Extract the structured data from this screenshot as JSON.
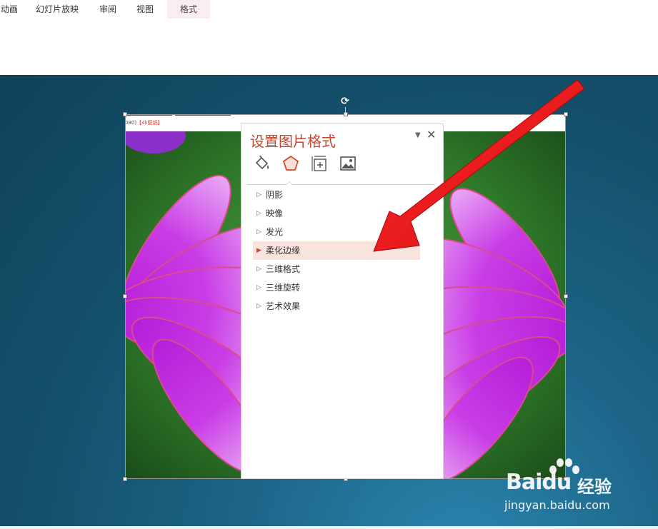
{
  "ribbon": {
    "tabs": [
      {
        "label": "动画",
        "active": false
      },
      {
        "label": "幻灯片放映",
        "active": false
      },
      {
        "label": "审阅",
        "active": false
      },
      {
        "label": "视图",
        "active": false
      },
      {
        "label": "格式",
        "active": true
      }
    ]
  },
  "picture": {
    "caption_prefix": "080)",
    "caption_red": "【4k壁纸】"
  },
  "pane": {
    "title": "设置图片格式",
    "dropdown_icon": "triangle-down-icon",
    "close_icon": "close-icon",
    "icons": [
      "fill-line-icon",
      "effects-pentagon-icon",
      "size-properties-icon",
      "picture-icon"
    ],
    "sections": [
      {
        "label": "阴影",
        "highlighted": false
      },
      {
        "label": "映像",
        "highlighted": false
      },
      {
        "label": "发光",
        "highlighted": false
      },
      {
        "label": "柔化边缘",
        "highlighted": true
      },
      {
        "label": "三维格式",
        "highlighted": false
      },
      {
        "label": "三维旋转",
        "highlighted": false
      },
      {
        "label": "艺术效果",
        "highlighted": false
      }
    ]
  },
  "watermark": {
    "brand": "Bai",
    "brand_suffix": "du",
    "cn": "经验",
    "url": "jingyan.baidu.com"
  },
  "colors": {
    "accent": "#c5482f",
    "highlight": "#f8e3dd",
    "arrow": "#e8161b",
    "canvas": "#14506c"
  }
}
